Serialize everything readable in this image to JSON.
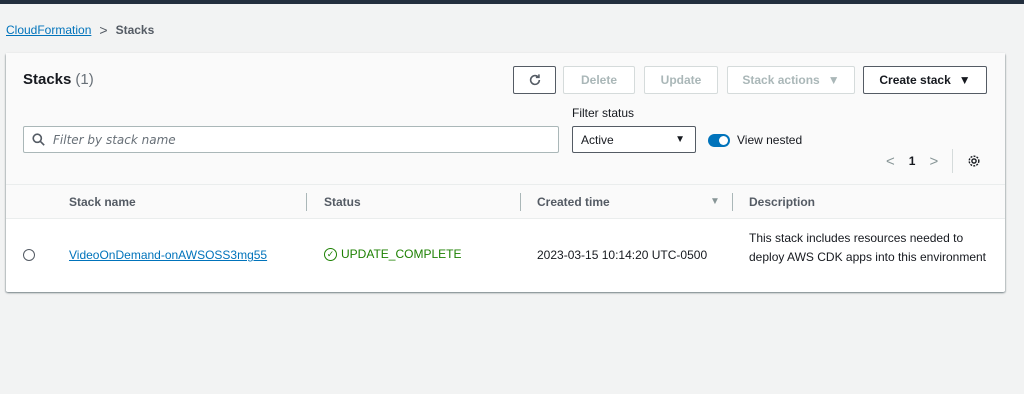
{
  "breadcrumb": {
    "root": "CloudFormation",
    "separator": ">",
    "current": "Stacks"
  },
  "header": {
    "title": "Stacks",
    "count": "(1)"
  },
  "toolbar": {
    "refresh_icon": "refresh-icon",
    "delete_label": "Delete",
    "update_label": "Update",
    "actions_label": "Stack actions",
    "create_label": "Create stack"
  },
  "filter": {
    "search_placeholder": "Filter by stack name",
    "status_label": "Filter status",
    "status_value": "Active",
    "view_nested_label": "View nested",
    "view_nested_on": true
  },
  "pagination": {
    "prev": "<",
    "page": "1",
    "next": ">"
  },
  "table": {
    "columns": [
      "Stack name",
      "Status",
      "Created time",
      "Description"
    ],
    "rows": [
      {
        "stack_name": "VideoOnDemand-onAWSOSS3mg55",
        "status": "UPDATE_COMPLETE",
        "created_time": "2023-03-15 10:14:20 UTC-0500",
        "description": "This stack includes resources needed to deploy AWS CDK apps into this environment"
      }
    ]
  },
  "colors": {
    "link": "#0073bb",
    "success": "#1d8102",
    "toggle": "#0073bb",
    "topbar": "#232f3e"
  }
}
